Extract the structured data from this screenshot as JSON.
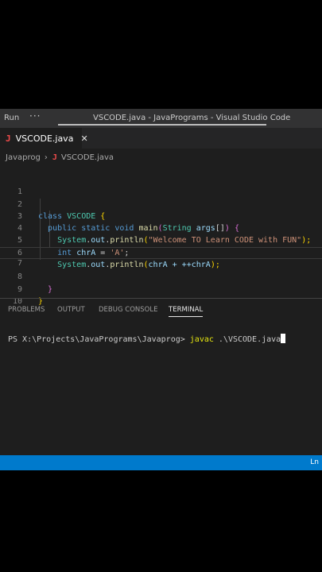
{
  "titlebar": {
    "menu_run": "Run",
    "menu_more": "···",
    "window_title": "VSCODE.java - JavaPrograms - Visual Studio Code"
  },
  "tab": {
    "icon_letter": "J",
    "label": "VSCODE.java",
    "close": "✕"
  },
  "breadcrumb": {
    "folder": "Javaprog",
    "separator": "›",
    "icon_letter": "J",
    "file": "VSCODE.java"
  },
  "editor": {
    "line_numbers": [
      "1",
      "2",
      "3",
      "4",
      "5",
      "6",
      "7",
      "8",
      "9",
      "10"
    ],
    "lines": {
      "l2": {
        "kw": "class",
        "name": "VSCODE",
        "brace": "{"
      },
      "l3": {
        "mod": "public static void",
        "fn": "main",
        "open": "(",
        "type": "String",
        "arg": "args",
        "arr": "[]",
        "close": ")",
        "brace": "{"
      },
      "l4": {
        "obj": "System",
        "dot1": ".",
        "field": "out",
        "dot2": ".",
        "fn": "println",
        "open": "(",
        "str": "\"Welcome TO Learn CODE with FUN\"",
        "close": ");"
      },
      "l5": {
        "type": "int",
        "var": "chrA",
        "eq": " = ",
        "str": "'A'",
        "semi": ";"
      },
      "l6": {
        "obj": "System",
        "dot1": ".",
        "field": "out",
        "dot2": ".",
        "fn": "println",
        "open": "(",
        "args": "chrA + ++chrA",
        "close": ");"
      },
      "l8": {
        "brace": "}"
      },
      "l9": {
        "brace": "}"
      }
    }
  },
  "panel": {
    "tabs": [
      "PROBLEMS",
      "OUTPUT",
      "DEBUG CONSOLE",
      "TERMINAL"
    ],
    "active_tab": "TERMINAL"
  },
  "terminal": {
    "prompt": "PS X:\\Projects\\JavaPrograms\\Javaprog> ",
    "command": "javac",
    "argument": " .\\VSCODE.java"
  },
  "statusbar": {
    "position": "Ln"
  },
  "colors": {
    "statusbar": "#007acc",
    "editor_bg": "#1e1e1e",
    "java_icon": "#f14c4c"
  }
}
